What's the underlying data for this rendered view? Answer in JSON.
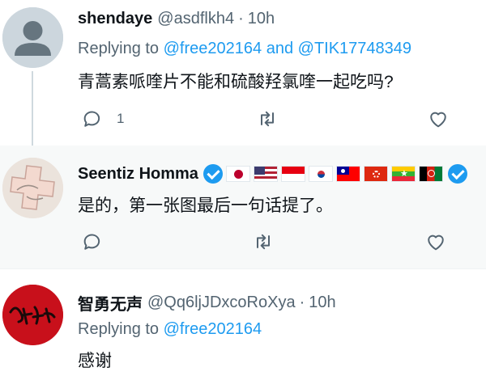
{
  "tweets": [
    {
      "display_name": "shendaye",
      "handle": "@asdflkh4",
      "separator": "·",
      "time": "10h",
      "replying_prefix": "Replying to",
      "replying_to_1": "@free202164",
      "replying_join": "and",
      "replying_to_2": "@TIK17748349",
      "text": "青蒿素哌喹片不能和硫酸羟氯喹一起吃吗?",
      "reply_count": "1",
      "avatar_icon": "default-avatar-icon"
    },
    {
      "display_name": "Seentiz Homma",
      "text": "是的，第一张图最后一句话提了。",
      "emoji_icons": [
        "blue-heart-icon",
        "japan-flag-icon",
        "usa-flag-icon",
        "indonesia-flag-icon",
        "south-korea-flag-icon",
        "taiwan-flag-icon",
        "hong-kong-flag-icon",
        "myanmar-flag-icon",
        "afghanistan-flag-icon",
        "blue-heart-icon"
      ]
    },
    {
      "display_name": "智勇无声",
      "handle": "@Qq6ljJDxcoRoXya",
      "separator": "·",
      "time": "10h",
      "replying_prefix": "Replying to",
      "replying_to_1": "@free202164",
      "text": "感谢",
      "avatar_lettering": "賀龍花母"
    }
  ],
  "colors": {
    "link": "#1d9bf0",
    "secondary_text": "#536471",
    "highlight_bg": "#f7f9f9"
  }
}
